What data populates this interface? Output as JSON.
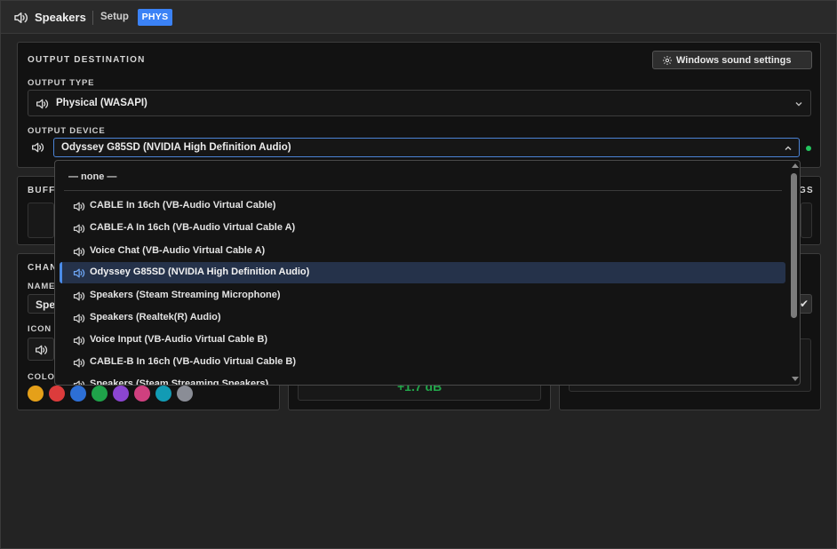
{
  "titlebar": {
    "title": "Speakers",
    "setup_label": "Setup",
    "badge": "PHYS"
  },
  "output_destination": {
    "heading": "OUTPUT DESTINATION",
    "windows_sound_button": "Windows sound settings",
    "output_type_label": "OUTPUT TYPE",
    "output_type_value": "Physical (WASAPI)",
    "output_device_label": "OUTPUT DEVICE",
    "output_device_value": "Odyssey G85SD (NVIDIA High Definition Audio)",
    "device_status_color": "#22c55e"
  },
  "buffer_panel": {
    "heading_fragment": "BUFF",
    "right_fragment": "GS"
  },
  "channel_panel": {
    "heading_fragment": "CHAN",
    "name_label_fragment": "NAME",
    "name_value_fragment": "Spe",
    "icon_label": "ICON",
    "color_label_fragment": "COLO",
    "colors": [
      "#e5a019",
      "#dc3c3c",
      "#2d6fd6",
      "#1fa34a",
      "#8b45d1",
      "#d0407f",
      "#129bb4",
      "#8a8d96"
    ]
  },
  "gain_panel": {
    "db_value_fragment": "+1.7 dB"
  },
  "dropdown": {
    "none_label": "— none —",
    "items": [
      {
        "label": "CABLE In 16ch (VB-Audio Virtual Cable)"
      },
      {
        "label": "CABLE-A In 16ch (VB-Audio Virtual Cable A)"
      },
      {
        "label": "Voice Chat (VB-Audio Virtual Cable A)"
      },
      {
        "label": "Odyssey G85SD (NVIDIA High Definition Audio)",
        "selected": true
      },
      {
        "label": "Speakers (Steam Streaming Microphone)"
      },
      {
        "label": "Speakers (Realtek(R) Audio)"
      },
      {
        "label": "Voice Input (VB-Audio Virtual Cable B)"
      },
      {
        "label": "CABLE-B In 16ch (VB-Audio Virtual Cable B)"
      },
      {
        "label": "Speakers (Steam Streaming Speakers)"
      }
    ],
    "accent_color": "#4a8be8"
  }
}
